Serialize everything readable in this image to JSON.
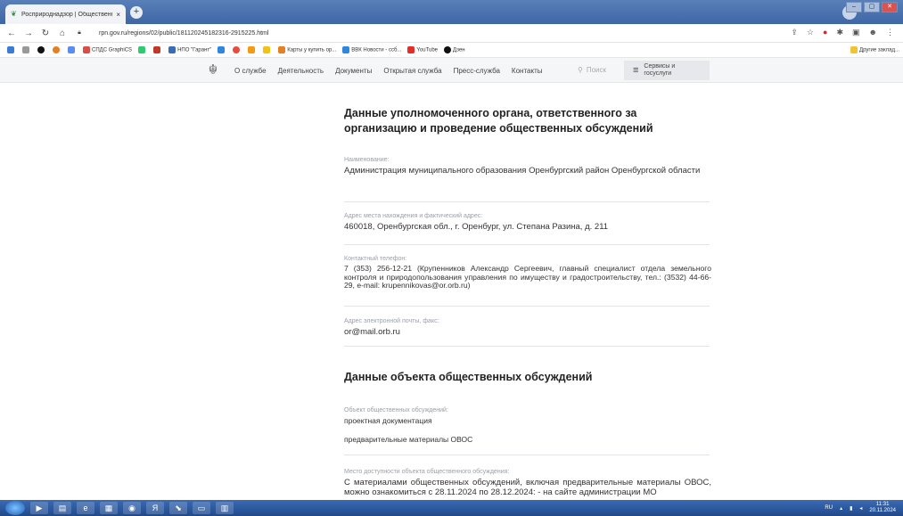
{
  "browser": {
    "tab_title": "Росприроднадзор | Общественн...",
    "tab_close": "×",
    "new_tab": "+",
    "url": "rpn.gov.ru/regions/02/public/181120245182316-2915225.html",
    "icons": [
      "back-icon",
      "forward-icon",
      "reload-icon",
      "home-icon",
      "lock-icon",
      "share-icon",
      "star-icon",
      "extension-icon",
      "profile-icon"
    ]
  },
  "bookmarks": {
    "items": [
      {
        "label": "СПДС GraphiCS",
        "color": "#d94f43"
      },
      {
        "label": "НПО \"Гарант\"",
        "color": "#3a6bb4"
      },
      {
        "label": "Карты у купить ор...",
        "color": "#e67e22"
      },
      {
        "label": "ВВК Новости - ссб...",
        "color": "#2e86de"
      },
      {
        "label": "YouTube",
        "color": "#e52d27"
      },
      {
        "label": "Дзен",
        "color": "#111111"
      }
    ],
    "other": "Другие заклад..."
  },
  "site": {
    "menu": [
      "О службе",
      "Деятельность",
      "Документы",
      "Открытая служба",
      "Пресс-служба",
      "Контакты"
    ],
    "search": "Поиск",
    "services": "Сервисы и госуслуги"
  },
  "content": {
    "section1_title": "Данные уполномоченного органа, ответственного за организацию и проведение общественных обсуждений",
    "name_label": "Наименование:",
    "name_value": "Администрация муниципального образования Оренбургский район Оренбургской области",
    "address_label": "Адрес места нахождения и фактический адрес:",
    "address_value": "460018, Оренбургская обл., г. Оренбург, ул. Степана Разина, д. 211",
    "phone_label": "Контактный телефон:",
    "phone_value": "7 (353) 256-12-21 (Крупенников Александр Сергеевич, главный специалист отдела земельного контроля и природопользования управления по имуществу и градостроительству, тел.: (3532) 44-66-29, e-mail: krupennikovas@or.orb.ru)",
    "email_label": "Адрес электронной почты, факс:",
    "email_value": "or@mail.orb.ru",
    "section2_title": "Данные объекта общественных обсуждений",
    "object_label": "Объект общественных обсуждений:",
    "object_values": [
      "проектная документация",
      "предварительные материалы ОВОС"
    ],
    "place_label": "Место доступности объекта общественного обсуждения:",
    "place_value": "С материалами общественных обсуждений, включая предварительные материалы ОВОС, можно ознакомиться с 28.11.2024 по 28.12.2024: - на сайте администрации МО"
  },
  "taskbar": {
    "lang": "RU",
    "time": "11:31",
    "date": "20.11.2024"
  }
}
